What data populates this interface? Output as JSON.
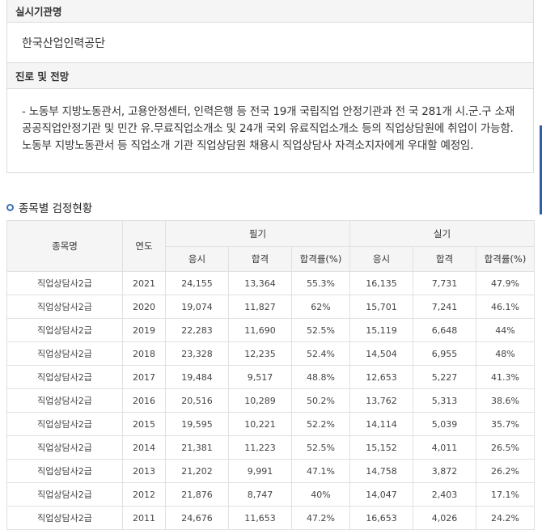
{
  "org": {
    "heading": "실시기관명",
    "value": "한국산업인력공단"
  },
  "career": {
    "heading": "진로 및 전망",
    "text": "- 노동부 지방노동관서, 고용안정센터, 인력은행 등 전국 19개 국립직업 안정기관과 전 국 281개 시.군.구 소재 공공직업안정기관 및 민간 유.무료직업소개소 및 24개 국외 유료직업소개소 등의 직업상담원에 취업이 가능함. 노동부 지방노동관서 등 직업소개 기관 직업상담원 채용시 직업상담사 자격소지자에게 우대할 예정임."
  },
  "stats": {
    "title": "종목별 검정현황",
    "headers": {
      "name": "종목명",
      "year": "연도",
      "written": "필기",
      "practical": "실기",
      "applicants": "응시",
      "passed": "합격",
      "rate": "합격률(%)"
    },
    "rows": [
      [
        "직업상담사2급",
        "2021",
        "24,155",
        "13,364",
        "55.3%",
        "16,135",
        "7,731",
        "47.9%"
      ],
      [
        "직업상담사2급",
        "2020",
        "19,074",
        "11,827",
        "62%",
        "15,701",
        "7,241",
        "46.1%"
      ],
      [
        "직업상담사2급",
        "2019",
        "22,283",
        "11,690",
        "52.5%",
        "15,119",
        "6,648",
        "44%"
      ],
      [
        "직업상담사2급",
        "2018",
        "23,328",
        "12,235",
        "52.4%",
        "14,504",
        "6,955",
        "48%"
      ],
      [
        "직업상담사2급",
        "2017",
        "19,484",
        "9,517",
        "48.8%",
        "12,653",
        "5,227",
        "41.3%"
      ],
      [
        "직업상담사2급",
        "2016",
        "20,516",
        "10,289",
        "50.2%",
        "13,762",
        "5,313",
        "38.6%"
      ],
      [
        "직업상담사2급",
        "2015",
        "19,595",
        "10,221",
        "52.2%",
        "14,114",
        "5,039",
        "35.7%"
      ],
      [
        "직업상담사2급",
        "2014",
        "21,381",
        "11,223",
        "52.5%",
        "15,152",
        "4,011",
        "26.5%"
      ],
      [
        "직업상담사2급",
        "2013",
        "21,202",
        "9,991",
        "47.1%",
        "14,758",
        "3,872",
        "26.2%"
      ],
      [
        "직업상담사2급",
        "2012",
        "21,876",
        "8,747",
        "40%",
        "14,047",
        "2,403",
        "17.1%"
      ],
      [
        "직업상담사2급",
        "2011",
        "24,676",
        "11,653",
        "47.2%",
        "16,653",
        "4,026",
        "24.2%"
      ]
    ]
  }
}
